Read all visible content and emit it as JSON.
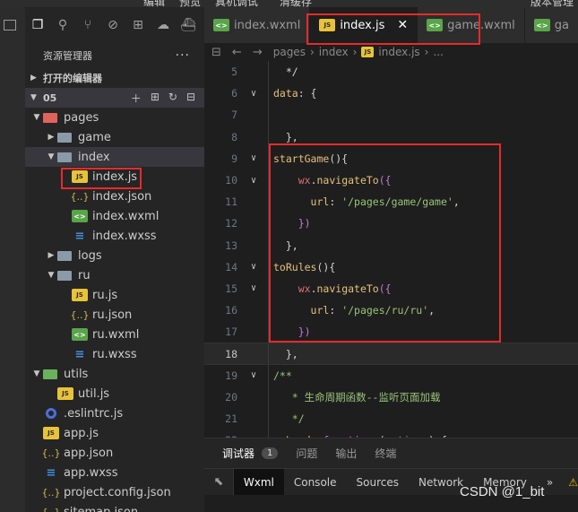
{
  "menubar": {
    "items": [
      "编辑",
      "预览",
      "真机调试",
      "清缓存",
      "版本管理"
    ]
  },
  "explorer": {
    "title": "资源管理器",
    "more": "···",
    "open_editors": "打开的编辑器",
    "project": "05",
    "tree": [
      {
        "label": "pages",
        "type": "folder-red",
        "depth": 1,
        "open": true
      },
      {
        "label": "game",
        "type": "folder-grey",
        "depth": 2,
        "open": false
      },
      {
        "label": "index",
        "type": "folder-grey",
        "depth": 2,
        "open": true,
        "sel": true
      },
      {
        "label": "index.js",
        "type": "js",
        "depth": 3
      },
      {
        "label": "index.json",
        "type": "json",
        "depth": 3
      },
      {
        "label": "index.wxml",
        "type": "wxml",
        "depth": 3
      },
      {
        "label": "index.wxss",
        "type": "wxss",
        "depth": 3
      },
      {
        "label": "logs",
        "type": "folder-grey",
        "depth": 2,
        "open": false
      },
      {
        "label": "ru",
        "type": "folder-grey",
        "depth": 2,
        "open": true
      },
      {
        "label": "ru.js",
        "type": "js",
        "depth": 3
      },
      {
        "label": "ru.json",
        "type": "json",
        "depth": 3
      },
      {
        "label": "ru.wxml",
        "type": "wxml",
        "depth": 3
      },
      {
        "label": "ru.wxss",
        "type": "wxss",
        "depth": 3
      },
      {
        "label": "utils",
        "type": "folder-green",
        "depth": 1,
        "open": true
      },
      {
        "label": "util.js",
        "type": "js",
        "depth": 2
      },
      {
        "label": ".eslintrc.js",
        "type": "eslint",
        "depth": 1
      },
      {
        "label": "app.js",
        "type": "js",
        "depth": 1
      },
      {
        "label": "app.json",
        "type": "json",
        "depth": 1
      },
      {
        "label": "app.wxss",
        "type": "wxss",
        "depth": 1
      },
      {
        "label": "project.config.json",
        "type": "json",
        "depth": 1
      },
      {
        "label": "sitemap.json",
        "type": "json",
        "depth": 1
      }
    ]
  },
  "tabs": [
    {
      "label": "index.wxml",
      "type": "wxml"
    },
    {
      "label": "index.js",
      "type": "js",
      "active": true,
      "close": "✕"
    },
    {
      "label": "game.wxml",
      "type": "wxml"
    },
    {
      "label": "ga",
      "type": "wxml"
    }
  ],
  "breadcrumb": {
    "parts": [
      "pages",
      "index",
      "index.js",
      "..."
    ]
  },
  "code": [
    {
      "n": "5",
      "t": [
        [
          "tok-default",
          "  */"
        ]
      ]
    },
    {
      "n": "6",
      "fold": "∨",
      "t": [
        [
          "tok-key",
          "data"
        ],
        [
          "tok-default",
          ": {"
        ]
      ]
    },
    {
      "n": "7",
      "t": []
    },
    {
      "n": "8",
      "t": [
        [
          "tok-default",
          "  },"
        ]
      ]
    },
    {
      "n": "9",
      "fold": "∨",
      "t": [
        [
          "tok-fn",
          "startGame"
        ],
        [
          "tok-default",
          "(){"
        ]
      ]
    },
    {
      "n": "10",
      "fold": "∨",
      "t": [
        [
          "tok-default",
          "    "
        ],
        [
          "tok-prop",
          "wx"
        ],
        [
          "tok-default",
          "."
        ],
        [
          "tok-fn",
          "navigateTo"
        ],
        [
          "tok-paren",
          "({"
        ]
      ]
    },
    {
      "n": "11",
      "t": [
        [
          "tok-default",
          "      "
        ],
        [
          "tok-key",
          "url"
        ],
        [
          "tok-default",
          ": "
        ],
        [
          "tok-str",
          "'/pages/game/game'"
        ],
        [
          "tok-default",
          ","
        ]
      ]
    },
    {
      "n": "12",
      "t": [
        [
          "tok-default",
          "    "
        ],
        [
          "tok-paren",
          "})"
        ]
      ]
    },
    {
      "n": "13",
      "t": [
        [
          "tok-default",
          "  },"
        ]
      ]
    },
    {
      "n": "14",
      "fold": "∨",
      "t": [
        [
          "tok-fn",
          "toRules"
        ],
        [
          "tok-default",
          "(){"
        ]
      ]
    },
    {
      "n": "15",
      "fold": "∨",
      "t": [
        [
          "tok-default",
          "    "
        ],
        [
          "tok-prop",
          "wx"
        ],
        [
          "tok-default",
          "."
        ],
        [
          "tok-fn",
          "navigateTo"
        ],
        [
          "tok-paren",
          "({"
        ]
      ]
    },
    {
      "n": "16",
      "t": [
        [
          "tok-default",
          "      "
        ],
        [
          "tok-key",
          "url"
        ],
        [
          "tok-default",
          ": "
        ],
        [
          "tok-str",
          "'/pages/ru/ru'"
        ],
        [
          "tok-default",
          ","
        ]
      ]
    },
    {
      "n": "17",
      "t": [
        [
          "tok-default",
          "    "
        ],
        [
          "tok-paren",
          "})"
        ]
      ]
    },
    {
      "n": "18",
      "cur": true,
      "t": [
        [
          "tok-default",
          "  },"
        ]
      ]
    },
    {
      "n": "19",
      "fold": "∨",
      "t": [
        [
          "tok-comment",
          "/**"
        ]
      ]
    },
    {
      "n": "20",
      "t": [
        [
          "tok-comment",
          "   * 生命周期函数--监听页面加载"
        ]
      ]
    },
    {
      "n": "21",
      "t": [
        [
          "tok-comment",
          "   */"
        ]
      ]
    },
    {
      "n": "22",
      "fold": "∨",
      "t": [
        [
          "tok-key",
          "onLoad"
        ],
        [
          "tok-default",
          ": "
        ],
        [
          "tok-kw",
          "function"
        ],
        [
          "tok-default",
          " ("
        ],
        [
          "tok-prop",
          "options"
        ],
        [
          "tok-default",
          ") {"
        ]
      ]
    }
  ],
  "panel": {
    "tabs": [
      {
        "label": "调试器",
        "badge": "1",
        "active": true
      },
      {
        "label": "问题"
      },
      {
        "label": "输出"
      },
      {
        "label": "终端"
      }
    ]
  },
  "devtools": {
    "tabs": [
      {
        "label": "Wxml",
        "active": true
      },
      {
        "label": "Console"
      },
      {
        "label": "Sources"
      },
      {
        "label": "Network"
      },
      {
        "label": "Memory"
      }
    ],
    "more": "»",
    "warn": "⚠"
  },
  "watermark": "CSDN @1_bit"
}
